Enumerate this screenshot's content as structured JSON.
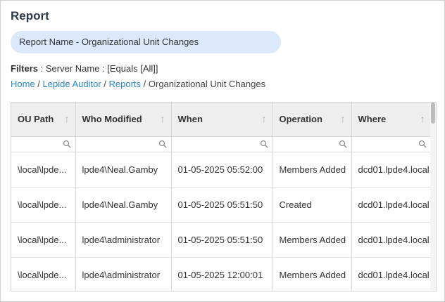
{
  "page": {
    "title": "Report",
    "report_name": "Report Name - Organizational Unit Changes",
    "filters_label": "Filters",
    "filters_value": " : Server Name : [Equals [All]]"
  },
  "breadcrumb": {
    "home": "Home",
    "lepide": "Lepide Auditor",
    "reports": "Reports",
    "current": "Organizational Unit Changes",
    "sep": " / "
  },
  "table": {
    "columns": [
      "OU Path",
      "Who Modified",
      "When",
      "Operation",
      "Where"
    ],
    "sort_icon": "sort-up-arrow-icon",
    "rows": [
      [
        "\\local\\lpde...",
        "lpde4\\Neal.Gamby",
        "01-05-2025 05:52:00",
        "Members Added",
        "dcd01.lpde4.local"
      ],
      [
        "\\local\\lpde...",
        "lpde4\\Neal.Gamby",
        "01-05-2025 05:51:50",
        "Created",
        "dcd01.lpde4.local"
      ],
      [
        "\\local\\lpde...",
        "lpde4\\administrator",
        "01-05-2025 05:51:50",
        "Members Added",
        "dcd01.lpde4.local"
      ],
      [
        "\\local\\lpde...",
        "lpde4\\administrator",
        "01-05-2025 12:00:01",
        "Members Added",
        "dcd01.lpde4.local"
      ]
    ]
  }
}
